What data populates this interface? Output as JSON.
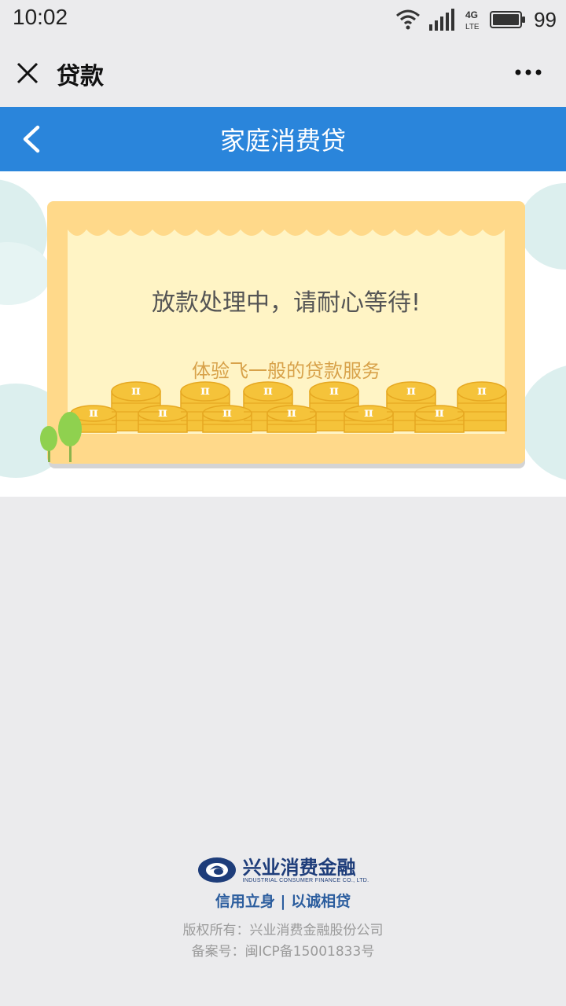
{
  "status_bar": {
    "time": "10:02",
    "battery_level": "99",
    "network": "4G LTE"
  },
  "wechat_header": {
    "title": "贷款"
  },
  "nav": {
    "title": "家庭消费贷"
  },
  "banner": {
    "message": "放款处理中，请耐心等待!",
    "subtitle": "体验飞一般的贷款服务",
    "coin_symbol": "π"
  },
  "footer": {
    "logo_cn": "兴业消费金融",
    "logo_en": "INDUSTRIAL CONSUMER FINANCE CO., LTD.",
    "slogan": "信用立身 | 以诚相贷",
    "copyright": "版权所有：兴业消费金融股份公司",
    "icp": "备案号：闽ICP备15001833号"
  },
  "colors": {
    "nav_blue": "#2a85db",
    "card_frame": "#ffd98a",
    "coin_gold": "#f5c33a",
    "logo_navy": "#1e3d7a"
  }
}
